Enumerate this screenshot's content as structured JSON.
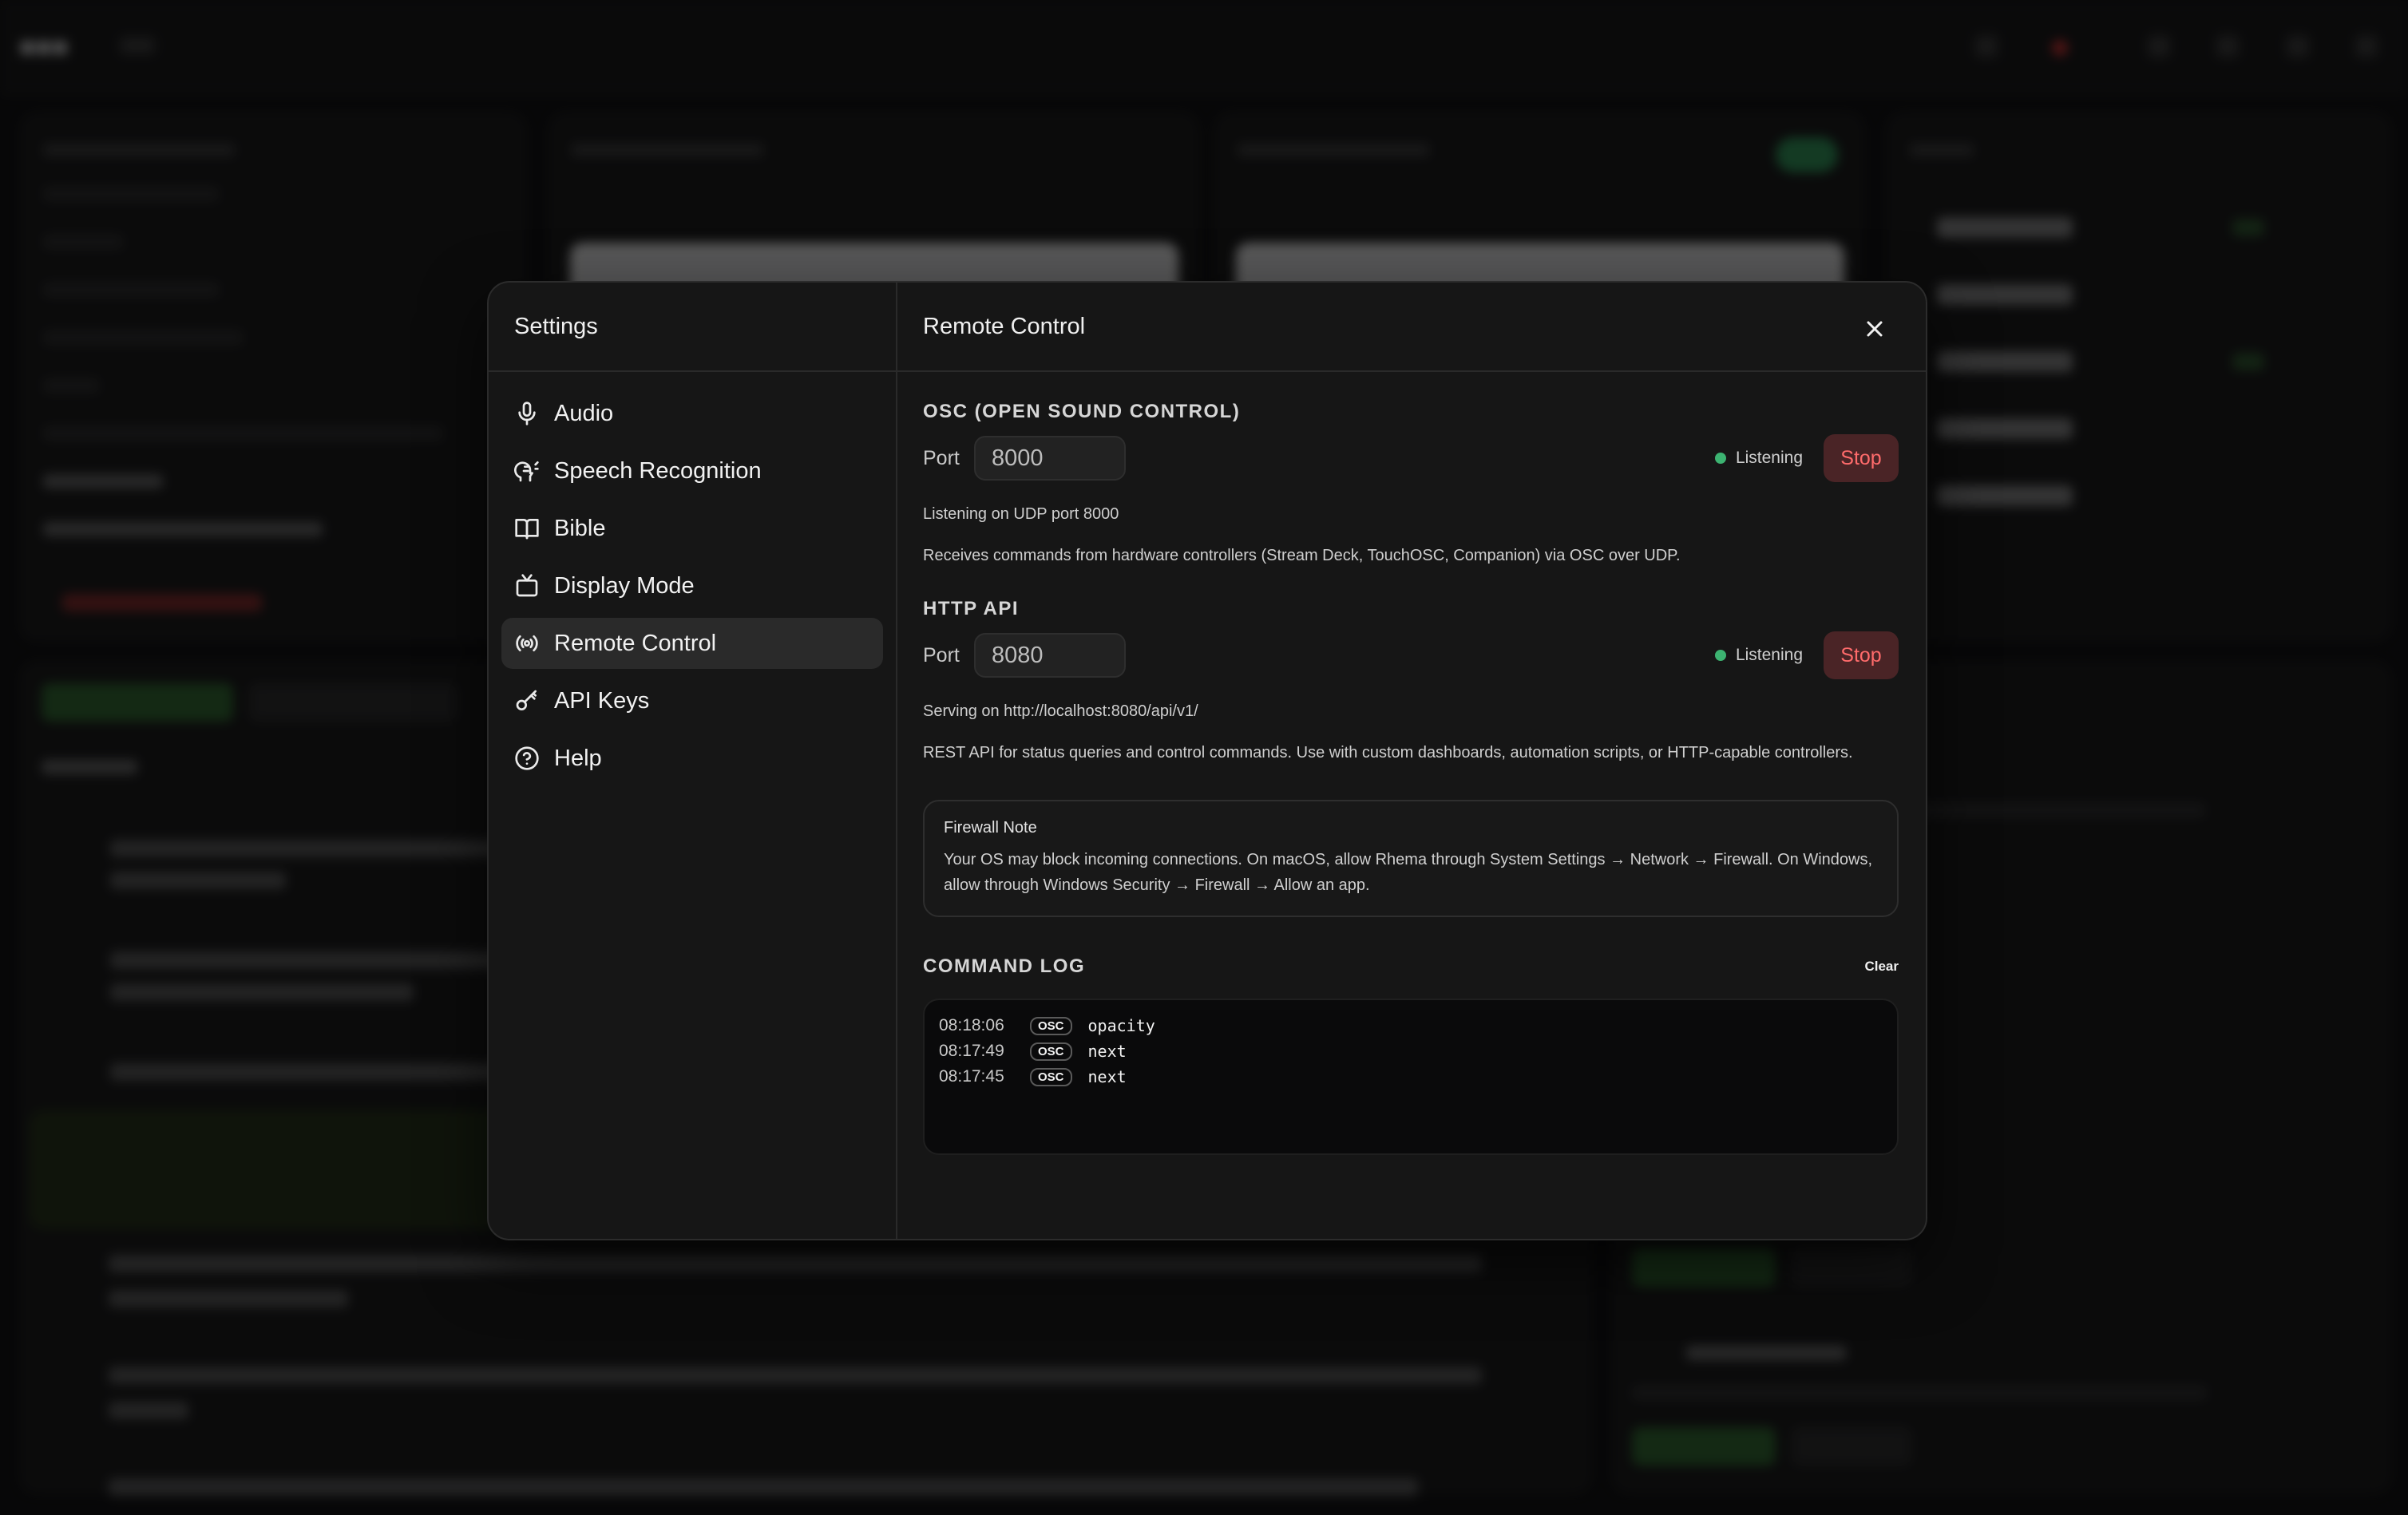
{
  "settings": {
    "title": "Settings",
    "nav": [
      {
        "label": "Audio",
        "icon": "microphone-icon"
      },
      {
        "label": "Speech Recognition",
        "icon": "speech-recognition-icon"
      },
      {
        "label": "Bible",
        "icon": "book-icon"
      },
      {
        "label": "Display Mode",
        "icon": "tv-icon"
      },
      {
        "label": "Remote Control",
        "icon": "broadcast-icon"
      },
      {
        "label": "API Keys",
        "icon": "key-icon"
      },
      {
        "label": "Help",
        "icon": "help-circle-icon"
      }
    ],
    "active_nav": "Remote Control"
  },
  "remote_control": {
    "title": "Remote Control",
    "osc": {
      "heading": "OSC (OPEN SOUND CONTROL)",
      "port_label": "Port",
      "port_value": "8000",
      "status": "Listening",
      "stop_label": "Stop",
      "listening_text": "Listening on UDP port 8000",
      "description": "Receives commands from hardware controllers (Stream Deck, TouchOSC, Companion) via OSC over UDP."
    },
    "http": {
      "heading": "HTTP API",
      "port_label": "Port",
      "port_value": "8080",
      "status": "Listening",
      "stop_label": "Stop",
      "serving_text": "Serving on http://localhost:8080/api/v1/",
      "description": "REST API for status queries and control commands. Use with custom dashboards, automation scripts, or HTTP-capable controllers."
    },
    "firewall": {
      "title": "Firewall Note",
      "text": "Your OS may block incoming connections. On macOS, allow Rhema through System Settings → Network → Firewall. On Windows, allow through Windows Security → Firewall → Allow an app."
    },
    "command_log": {
      "heading": "COMMAND LOG",
      "clear_label": "Clear",
      "entries": [
        {
          "time": "08:18:06",
          "tag": "OSC",
          "command": "opacity"
        },
        {
          "time": "08:17:49",
          "tag": "OSC",
          "command": "next"
        },
        {
          "time": "08:17:45",
          "tag": "OSC",
          "command": "next"
        }
      ]
    }
  },
  "colors": {
    "listening": "#3cb371",
    "stop_text": "#ff6b6b",
    "stop_bg": "#4a2426",
    "modal_bg": "#161616"
  }
}
